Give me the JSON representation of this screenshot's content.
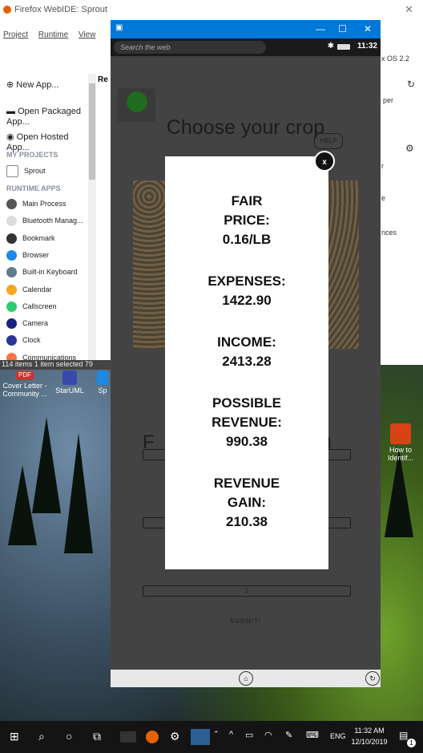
{
  "ide": {
    "title": "Firefox WebIDE: Sprout",
    "menu": [
      "Project",
      "Runtime",
      "View"
    ],
    "sidebar": {
      "actions": [
        {
          "label": "New App...",
          "icon": "plus-icon"
        },
        {
          "label": "Open Packaged\nApp...",
          "icon": "folder-icon"
        },
        {
          "label": "Open Hosted\nApp...",
          "icon": "globe-icon"
        }
      ],
      "my_projects_header": "MY PROJECTS",
      "project": "Sprout",
      "runtime_apps_header": "RUNTIME APPS",
      "runtime_apps": [
        {
          "label": "Main Process",
          "color": "#555555"
        },
        {
          "label": "Bluetooth Manag...",
          "color": "#dddddd"
        },
        {
          "label": "Bookmark",
          "color": "#333333"
        },
        {
          "label": "Browser",
          "color": "#1e88e5"
        },
        {
          "label": "Built-in Keyboard",
          "color": "#607d8b"
        },
        {
          "label": "Calendar",
          "color": "#f5a623"
        },
        {
          "label": "Callscreen",
          "color": "#2ecc71"
        },
        {
          "label": "Camera",
          "color": "#1a237e"
        },
        {
          "label": "Clock",
          "color": "#283593"
        },
        {
          "label": "Communications",
          "color": "#ff7043"
        }
      ]
    },
    "tab_fragment": "Re",
    "right_fragments": [
      "x OS 2.2",
      "per",
      "r",
      "e",
      "nces"
    ],
    "status": "114 items   1 item selected  79"
  },
  "desktop": {
    "icons": [
      {
        "label": "Cover Letter - Community ...",
        "badge": "PDF"
      },
      {
        "label": "StarUML",
        "badge": ""
      },
      {
        "label": "Sp",
        "badge": ""
      },
      {
        "label": "How to Identif...",
        "badge": ""
      }
    ]
  },
  "simulator": {
    "search_placeholder": "Search the web",
    "clock": "11:32",
    "app": {
      "title": "Choose your crop",
      "help": "HELP",
      "title_fragment_left": "F",
      "title_fragment_right": ")",
      "submit": "SUBMIT!",
      "field_value": "1"
    }
  },
  "modal": {
    "close": "x",
    "stats": [
      {
        "label": "FAIR\nPRICE:",
        "value": "0.16/LB"
      },
      {
        "label": "EXPENSES:",
        "value": "1422.90"
      },
      {
        "label": "INCOME:",
        "value": "2413.28"
      },
      {
        "label": "POSSIBLE\nREVENUE:",
        "value": "990.38"
      },
      {
        "label": "REVENUE\nGAIN:",
        "value": "210.38"
      }
    ]
  },
  "taskbar": {
    "language": "ENG",
    "time": "11:32 AM",
    "date": "12/10/2019",
    "notification_count": "1"
  }
}
